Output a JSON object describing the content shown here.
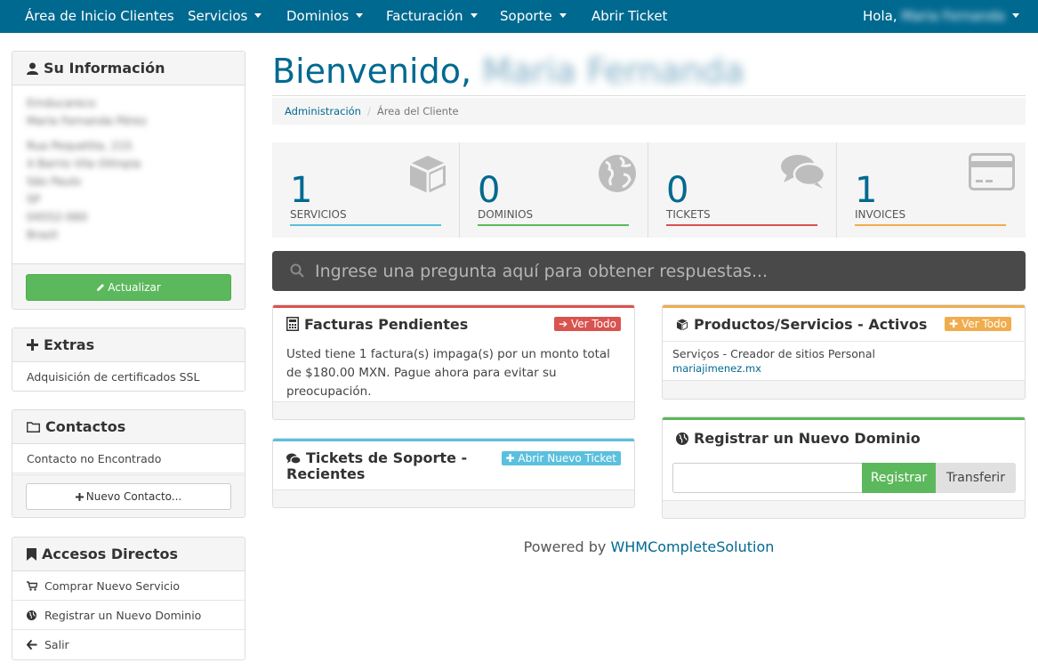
{
  "nav": {
    "home": "Área de Inicio Clientes",
    "services": "Servicios",
    "domains": "Dominios",
    "billing": "Facturación",
    "support": "Soporte",
    "open_ticket": "Abrir Ticket",
    "greeting": "Hola,",
    "user_name": "Maria Fernanda"
  },
  "sidebar": {
    "info": {
      "title": "Su Información",
      "company": "Emducareco",
      "name": "Maria Fernanda Pérez",
      "address": [
        "Rua Pequetita, 215",
        "4 Barrio Vila Olímpia",
        "São Paulo",
        "SP",
        "04552-060",
        "Brazil"
      ],
      "update_label": "Actualizar"
    },
    "extras": {
      "title": "Extras",
      "item": "Adquisición de certificados SSL"
    },
    "contacts": {
      "title": "Contactos",
      "empty": "Contacto no Encontrado",
      "new_label": "Nuevo Contacto..."
    },
    "shortcuts": {
      "title": "Accesos Directos",
      "items": [
        "Comprar Nuevo Servicio",
        "Registrar un Nuevo Dominio",
        "Salir"
      ]
    }
  },
  "main": {
    "welcome": "Bienvenido,",
    "welcome_name": "Maria Fernanda",
    "breadcrumb": {
      "root": "Administración",
      "current": "Área del Cliente"
    },
    "stats": [
      {
        "value": "1",
        "label": "SERVICIOS",
        "color": "#5bc0de"
      },
      {
        "value": "0",
        "label": "DOMINIOS",
        "color": "#5cb85c"
      },
      {
        "value": "0",
        "label": "TICKETS",
        "color": "#d9534f"
      },
      {
        "value": "1",
        "label": "INVOICES",
        "color": "#f0ad4e"
      }
    ],
    "search_placeholder": "Ingrese una pregunta aquí para obtener respuestas...",
    "invoices": {
      "title": "Facturas Pendientes",
      "view_all": "Ver Todo",
      "text": "Usted tiene 1 factura(s) impaga(s) por un monto total de $180.00 MXN. Pague ahora para evitar su preocupación."
    },
    "tickets": {
      "title": "Tickets de Soporte - Recientes",
      "open_new": "Abrir Nuevo Ticket"
    },
    "products": {
      "title": "Productos/Servicios - Activos",
      "view_all": "Ver Todo",
      "item_name": "Serviços - Creador de sitios Personal",
      "item_domain": "mariajimenez.mx"
    },
    "register_domain": {
      "title": "Registrar un Nuevo Dominio",
      "register_label": "Registrar",
      "transfer_label": "Transferir",
      "input_value": ""
    },
    "powered_prefix": "Powered by",
    "powered_link": "WHMCompleteSolution"
  },
  "colors": {
    "brand": "#006990",
    "success": "#5cb85c",
    "danger": "#d9534f",
    "info": "#5bc0de",
    "warning": "#f0ad4e"
  }
}
